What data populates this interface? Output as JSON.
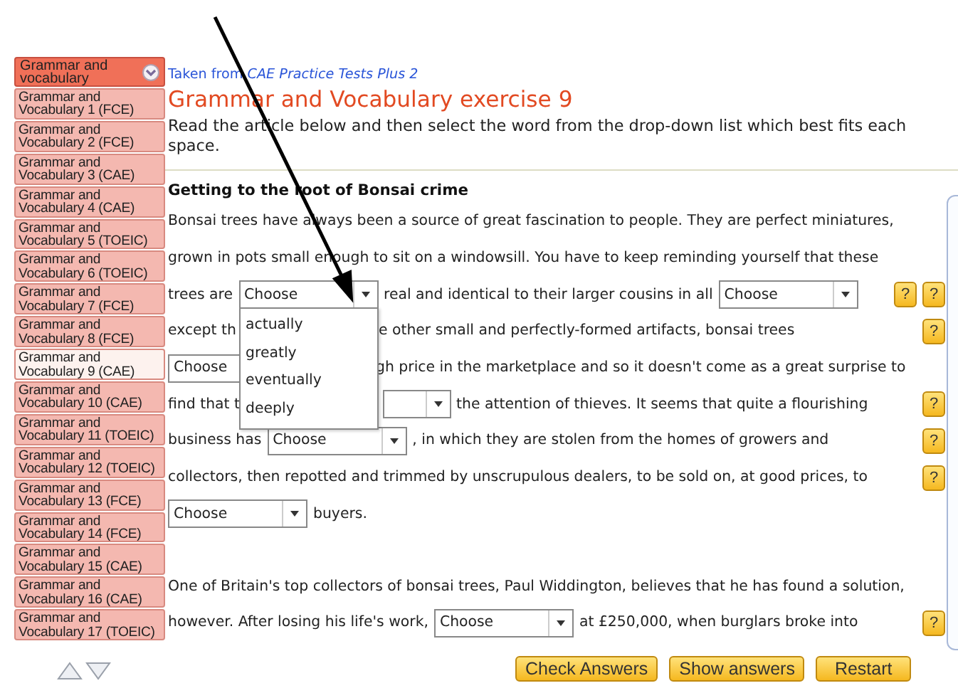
{
  "sidebar": {
    "header": {
      "label": "Grammar and vocabulary"
    },
    "items": [
      {
        "label": "Grammar and Vocabulary 1 (FCE)",
        "selected": false
      },
      {
        "label": "Grammar and Vocabulary 2 (FCE)",
        "selected": false
      },
      {
        "label": "Grammar and Vocabulary 3 (CAE)",
        "selected": false
      },
      {
        "label": "Grammar and Vocabulary 4 (CAE)",
        "selected": false
      },
      {
        "label": "Grammar and Vocabulary 5 (TOEIC)",
        "selected": false
      },
      {
        "label": "Grammar and Vocabulary 6 (TOEIC)",
        "selected": false
      },
      {
        "label": "Grammar and Vocabulary 7 (FCE)",
        "selected": false
      },
      {
        "label": "Grammar and Vocabulary 8 (FCE)",
        "selected": false
      },
      {
        "label": "Grammar and Vocabulary 9 (CAE)",
        "selected": true
      },
      {
        "label": "Grammar and Vocabulary 10 (CAE)",
        "selected": false
      },
      {
        "label": "Grammar and Vocabulary 11 (TOEIC)",
        "selected": false
      },
      {
        "label": "Grammar and Vocabulary 12 (TOEIC)",
        "selected": false
      },
      {
        "label": "Grammar and Vocabulary 13 (FCE)",
        "selected": false
      },
      {
        "label": "Grammar and Vocabulary 14 (FCE)",
        "selected": false
      },
      {
        "label": "Grammar and Vocabulary 15 (CAE)",
        "selected": false
      },
      {
        "label": "Grammar and Vocabulary 16 (CAE)",
        "selected": false
      },
      {
        "label": "Grammar and Vocabulary 17 (TOEIC)",
        "selected": false
      }
    ]
  },
  "source": "Taken from *CAE Practice Tests Plus 2*",
  "title": "Grammar and Vocabulary exercise 9",
  "instructions": "Read the article below and then select the word from the drop-down list which best fits each space.",
  "article": {
    "heading": "Getting to the root of Bonsai crime",
    "paragraphs": [
      {
        "lines": [
          {
            "segments": [
              {
                "kind": "text",
                "text": "Bonsai trees have always been a source of great fascination to people. They are perfect miniatures,"
              }
            ]
          },
          {
            "segments": [
              {
                "kind": "text",
                "text": "grown in pots small enough to sit on a windowsill. You have to keep reminding yourself that these"
              }
            ]
          },
          {
            "segments": [
              {
                "kind": "text",
                "text": "trees are"
              },
              {
                "kind": "select",
                "value": "Choose",
                "open": true,
                "options": [
                  "actually",
                  "greatly",
                  "eventually",
                  "deeply"
                ]
              },
              {
                "kind": "text",
                "text": "real and identical to their larger cousins in all"
              },
              {
                "kind": "select",
                "value": "Choose"
              }
            ],
            "help": [
              "?",
              "?"
            ]
          },
          {
            "segments": [
              {
                "kind": "text",
                "text": "except th"
              },
              {
                "kind": "covered"
              },
              {
                "kind": "text",
                "text": "e other small and perfectly-formed artifacts, bonsai trees"
              }
            ],
            "help": [
              "?"
            ]
          },
          {
            "segments": [
              {
                "kind": "select",
                "value": "Choose"
              },
              {
                "kind": "covered_short"
              },
              {
                "kind": "text",
                "text": "gh price in the marketplace and so it doesn't come as a great surprise to"
              }
            ]
          },
          {
            "segments": [
              {
                "kind": "text",
                "text": "find that t"
              },
              {
                "kind": "covered"
              },
              {
                "kind": "select_tail"
              },
              {
                "kind": "text",
                "text": "the attention of thieves. It seems that quite a flourishing"
              }
            ],
            "help": [
              "?"
            ]
          },
          {
            "segments": [
              {
                "kind": "text",
                "text": "business has"
              },
              {
                "kind": "select",
                "value": "Choose"
              },
              {
                "kind": "text",
                "text": ", in which they are stolen from the homes of growers and"
              }
            ],
            "help": [
              "?"
            ]
          },
          {
            "segments": [
              {
                "kind": "text",
                "text": "collectors, then repotted and trimmed by unscrupulous dealers, to be sold on, at good prices, to"
              }
            ],
            "help": [
              "?"
            ]
          },
          {
            "segments": [
              {
                "kind": "select",
                "value": "Choose"
              },
              {
                "kind": "text",
                "text": "buyers."
              }
            ]
          }
        ]
      },
      {
        "lines": [
          {
            "segments": [
              {
                "kind": "text",
                "text": "One of Britain's top collectors of bonsai trees, Paul Widdington, believes that he has found a solution,"
              }
            ]
          },
          {
            "segments": [
              {
                "kind": "text",
                "text": "however. After losing his life's work,"
              },
              {
                "kind": "select",
                "value": "Choose"
              },
              {
                "kind": "text",
                "text": "at £250,000, when burglars broke into"
              }
            ],
            "help": [
              "?"
            ]
          }
        ]
      }
    ]
  },
  "buttons": [
    "Check Answers",
    "Show answers",
    "Restart"
  ]
}
